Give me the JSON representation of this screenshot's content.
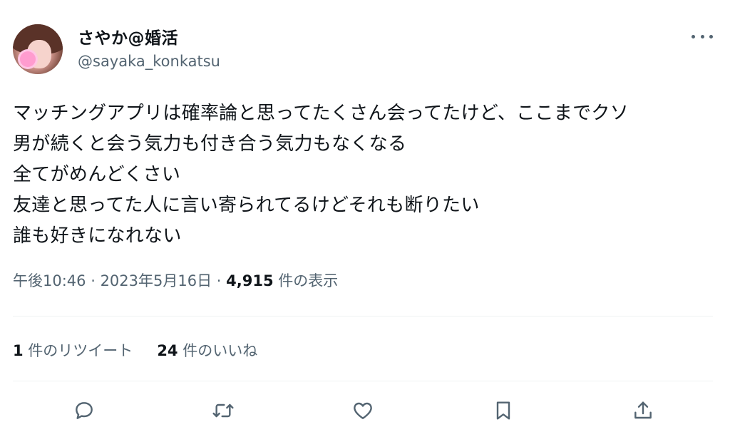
{
  "author": {
    "display_name": "さやか@婚活",
    "handle": "@sayaka_konkatsu",
    "avatar_icon": "profile-photo"
  },
  "tweet": {
    "lines": [
      "マッチングアプリは確率論と思ってたくさん会ってたけど、ここまでクソ",
      "男が続くと会う気力も付き合う気力もなくなる",
      "全てがめんどくさい",
      "友達と思ってた人に言い寄られてるけどそれも断りたい",
      "誰も好きになれない"
    ]
  },
  "meta": {
    "time": "午後10:46",
    "separator": " · ",
    "date": "2023年5月16日",
    "views_count": "4,915",
    "views_label": " 件の表示"
  },
  "stats": {
    "retweets_count": "1",
    "retweets_label": " 件のリツイート",
    "likes_count": "24",
    "likes_label": " 件のいいね"
  },
  "icons": {
    "more": "more-horizontal-icon",
    "reply": "reply-icon",
    "retweet": "retweet-icon",
    "like": "heart-icon",
    "bookmark": "bookmark-icon",
    "share": "share-icon"
  },
  "colors": {
    "text": "#0f1419",
    "secondary": "#536471",
    "divider": "#eff3f4"
  }
}
